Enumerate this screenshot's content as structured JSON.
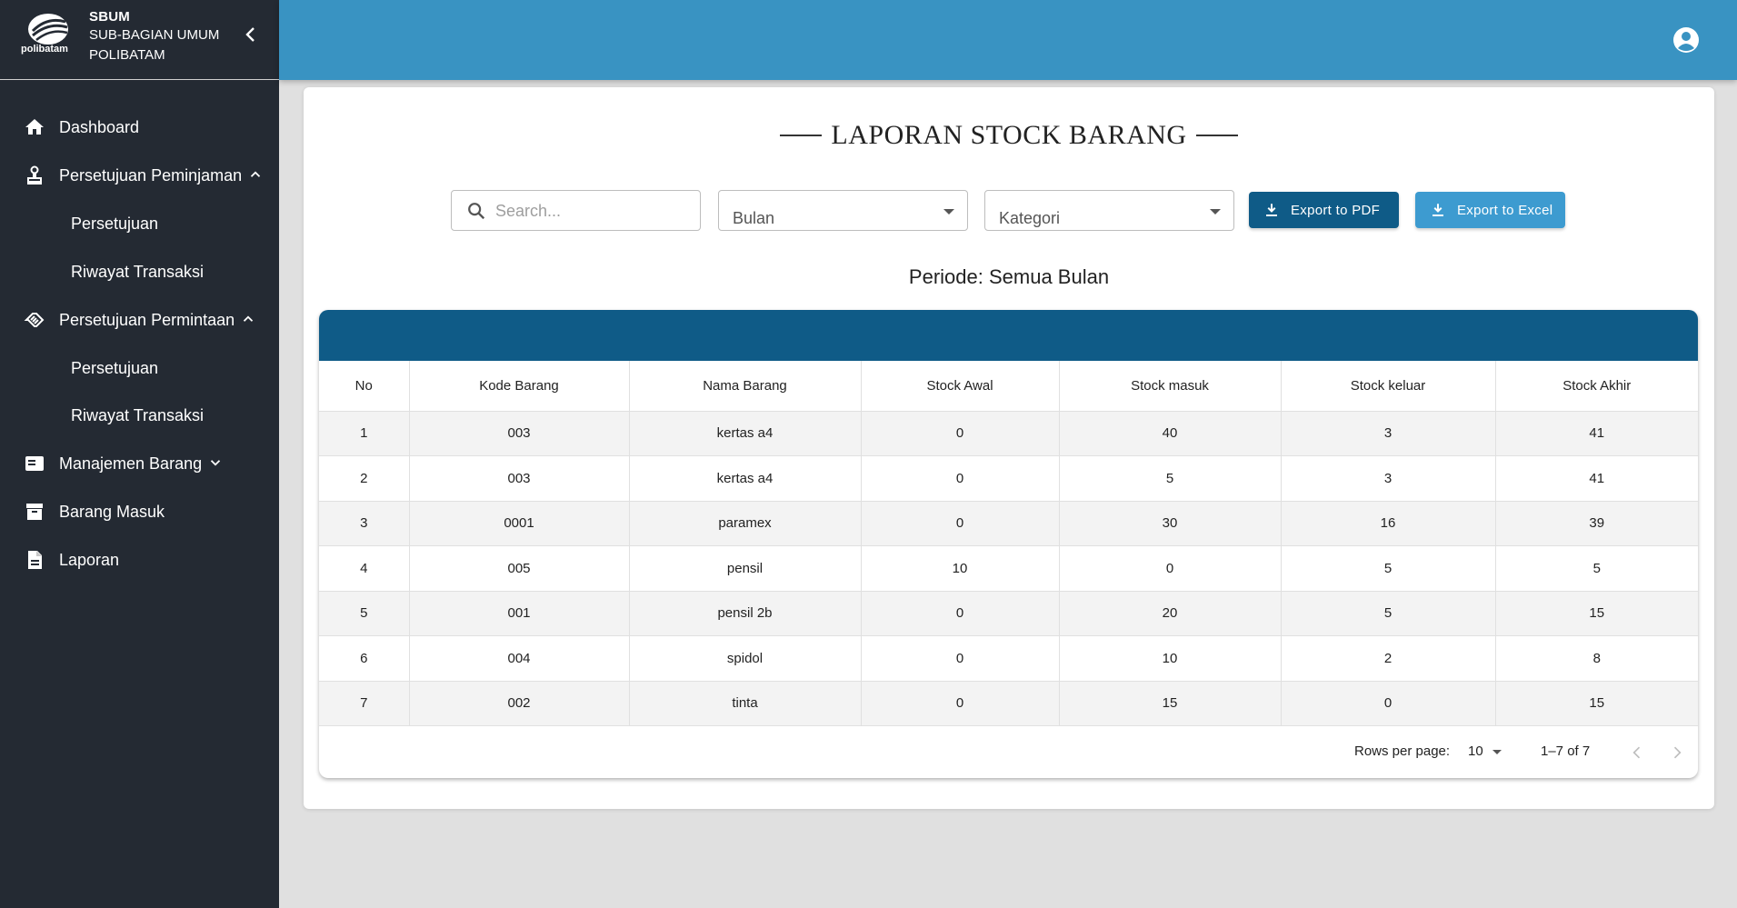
{
  "brand": {
    "logo_text": "polibatam",
    "title": "SBUM",
    "subtitle_line1": "SUB-BAGIAN UMUM",
    "subtitle_line2": "POLIBATAM"
  },
  "sidebar": {
    "items": [
      {
        "label": "Dashboard",
        "icon": "home-icon"
      },
      {
        "label": "Persetujuan Peminjaman",
        "icon": "person-stamp-icon",
        "expanded": true
      },
      {
        "label": "Persetujuan",
        "sub": true
      },
      {
        "label": "Riwayat Transaksi",
        "sub": true
      },
      {
        "label": "Persetujuan Permintaan",
        "icon": "handshake-icon",
        "expanded": true
      },
      {
        "label": "Persetujuan",
        "sub": true
      },
      {
        "label": "Riwayat Transaksi",
        "sub": true
      },
      {
        "label": "Manajemen Barang",
        "icon": "inventory-icon",
        "expanded": false
      },
      {
        "label": "Barang Masuk",
        "icon": "archive-icon"
      },
      {
        "label": "Laporan",
        "icon": "document-icon"
      }
    ]
  },
  "main": {
    "title": "LAPORAN STOCK BARANG",
    "search_placeholder": "Search...",
    "filter_bulan": "Bulan",
    "filter_kategori": "Kategori",
    "export_pdf": "Export to PDF",
    "export_excel": "Export to Excel",
    "periode": "Periode: Semua Bulan"
  },
  "table": {
    "columns": [
      "No",
      "Kode Barang",
      "Nama Barang",
      "Stock Awal",
      "Stock masuk",
      "Stock keluar",
      "Stock Akhir"
    ],
    "rows": [
      [
        "1",
        "003",
        "kertas a4",
        "0",
        "40",
        "3",
        "41"
      ],
      [
        "2",
        "003",
        "kertas a4",
        "0",
        "5",
        "3",
        "41"
      ],
      [
        "3",
        "0001",
        "paramex",
        "0",
        "30",
        "16",
        "39"
      ],
      [
        "4",
        "005",
        "pensil",
        "10",
        "0",
        "5",
        "5"
      ],
      [
        "5",
        "001",
        "pensil 2b",
        "0",
        "20",
        "5",
        "15"
      ],
      [
        "6",
        "004",
        "spidol",
        "0",
        "10",
        "2",
        "8"
      ],
      [
        "7",
        "002",
        "tinta",
        "0",
        "15",
        "0",
        "15"
      ]
    ]
  },
  "pagination": {
    "rows_per_page_label": "Rows per page:",
    "rows_per_page_value": "10",
    "range": "1–7 of 7"
  },
  "colors": {
    "sidebar_bg": "#242a33",
    "topbar_bg": "#3993c2",
    "primary_dark": "#0f5b87",
    "primary_light": "#3d9bd0"
  }
}
